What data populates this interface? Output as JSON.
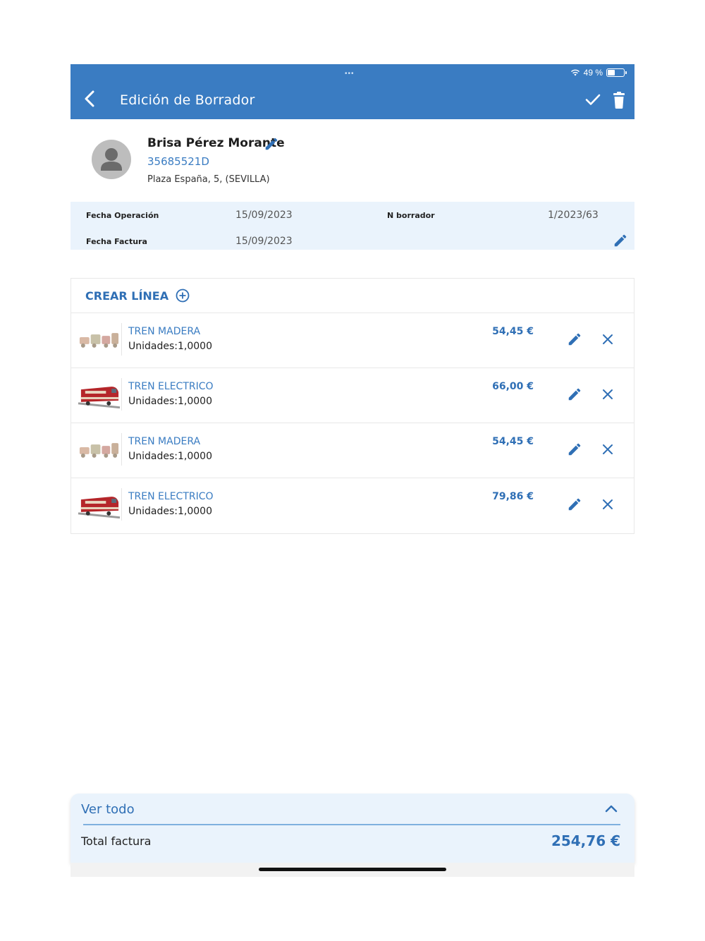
{
  "status_bar": {
    "dots": "•••",
    "battery_text": "49 %"
  },
  "header": {
    "title": "Edición de Borrador"
  },
  "client": {
    "name": "Brisa Pérez Morante",
    "id": "35685521D",
    "address": "Plaza España, 5, (SEVILLA)"
  },
  "info": {
    "fecha_operacion_label": "Fecha Operación",
    "fecha_operacion_value": "15/09/2023",
    "n_borrador_label": "N borrador",
    "n_borrador_value": "1/2023/63",
    "fecha_factura_label": "Fecha Factura",
    "fecha_factura_value": "15/09/2023"
  },
  "lines": {
    "create_label": "CREAR LÍNEA",
    "items": [
      {
        "name": "TREN MADERA",
        "units": "Unidades:1,0000",
        "price": "54,45 €",
        "image": "wooden-train"
      },
      {
        "name": "TREN ELECTRICO",
        "units": "Unidades:1,0000",
        "price": "66,00 €",
        "image": "electric-train"
      },
      {
        "name": "TREN MADERA",
        "units": "Unidades:1,0000",
        "price": "54,45 €",
        "image": "wooden-train"
      },
      {
        "name": "TREN ELECTRICO",
        "units": "Unidades:1,0000",
        "price": "79,86 €",
        "image": "electric-train"
      }
    ]
  },
  "footer": {
    "ver_todo": "Ver todo",
    "total_label": "Total factura",
    "total_value": "254,76 €"
  },
  "colors": {
    "primary": "#3a7cc2",
    "accent_text": "#2f6fb5",
    "info_bg": "#eaf3fc"
  }
}
